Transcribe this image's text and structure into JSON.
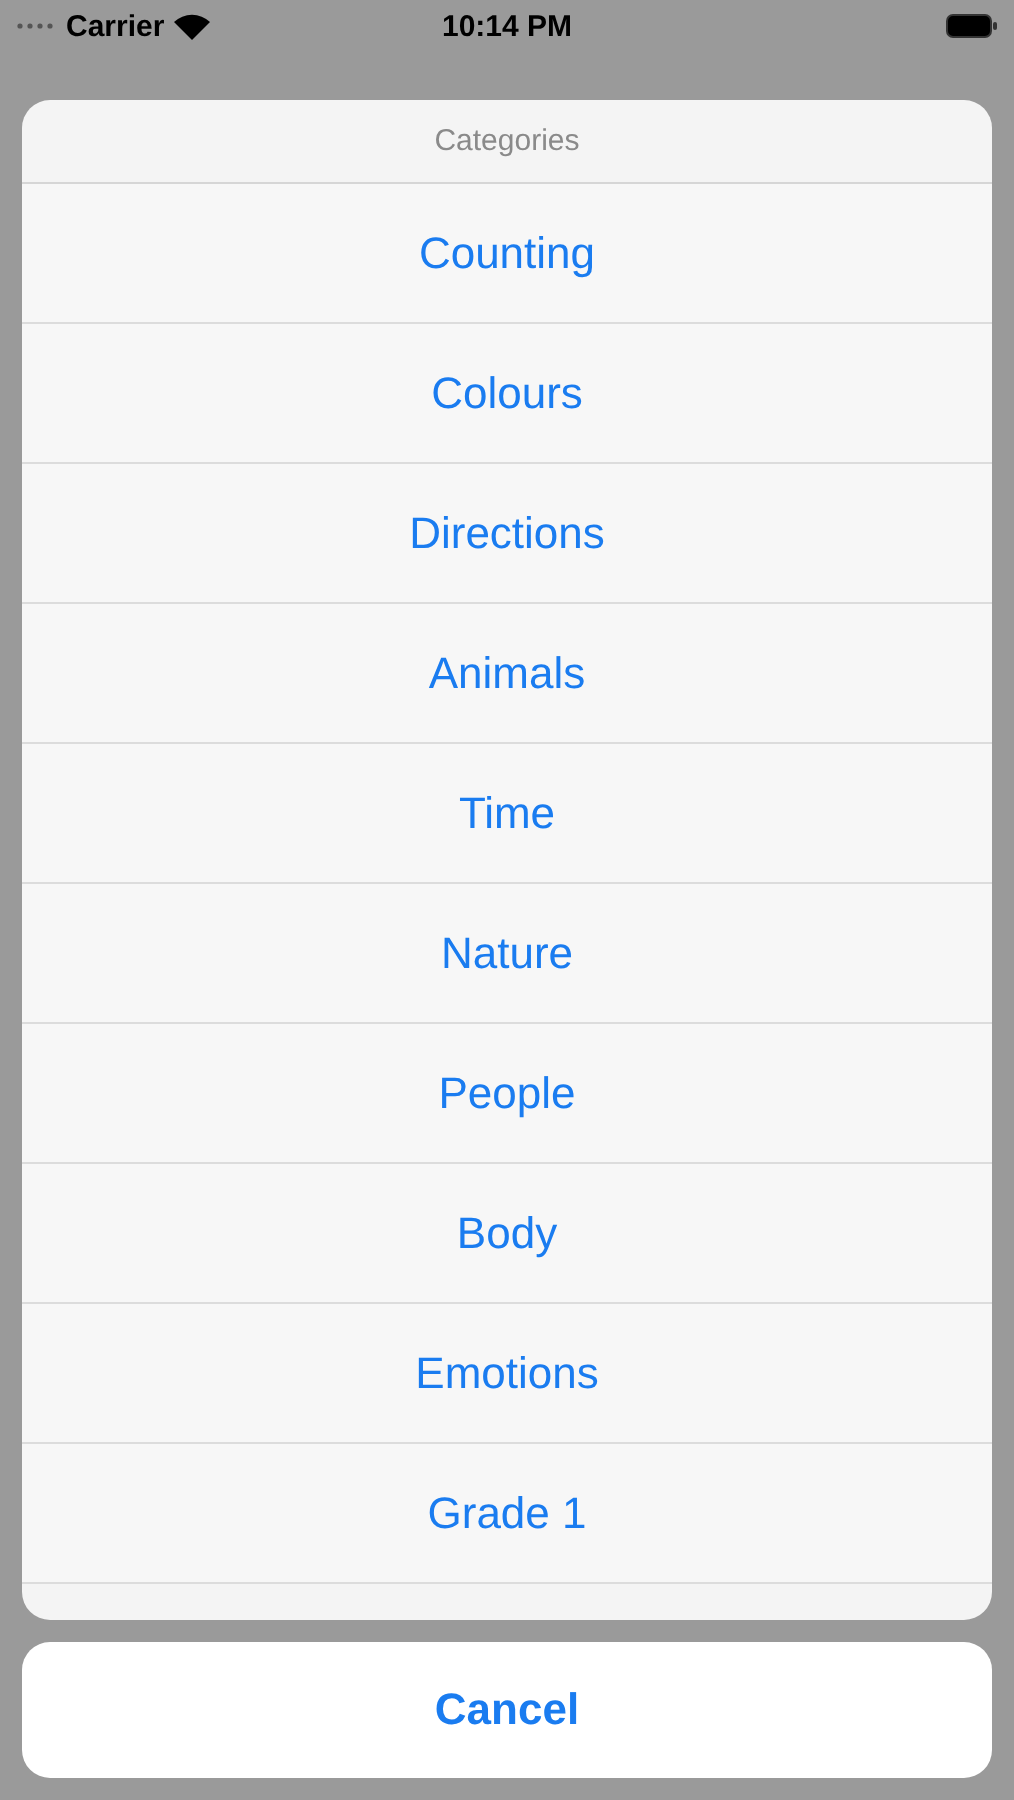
{
  "status_bar": {
    "carrier": "Carrier",
    "time": "10:14 PM"
  },
  "action_sheet": {
    "title": "Categories",
    "items": [
      "Counting",
      "Colours",
      "Directions",
      "Animals",
      "Time",
      "Nature",
      "People",
      "Body",
      "Emotions",
      "Grade 1"
    ],
    "cancel": "Cancel"
  }
}
